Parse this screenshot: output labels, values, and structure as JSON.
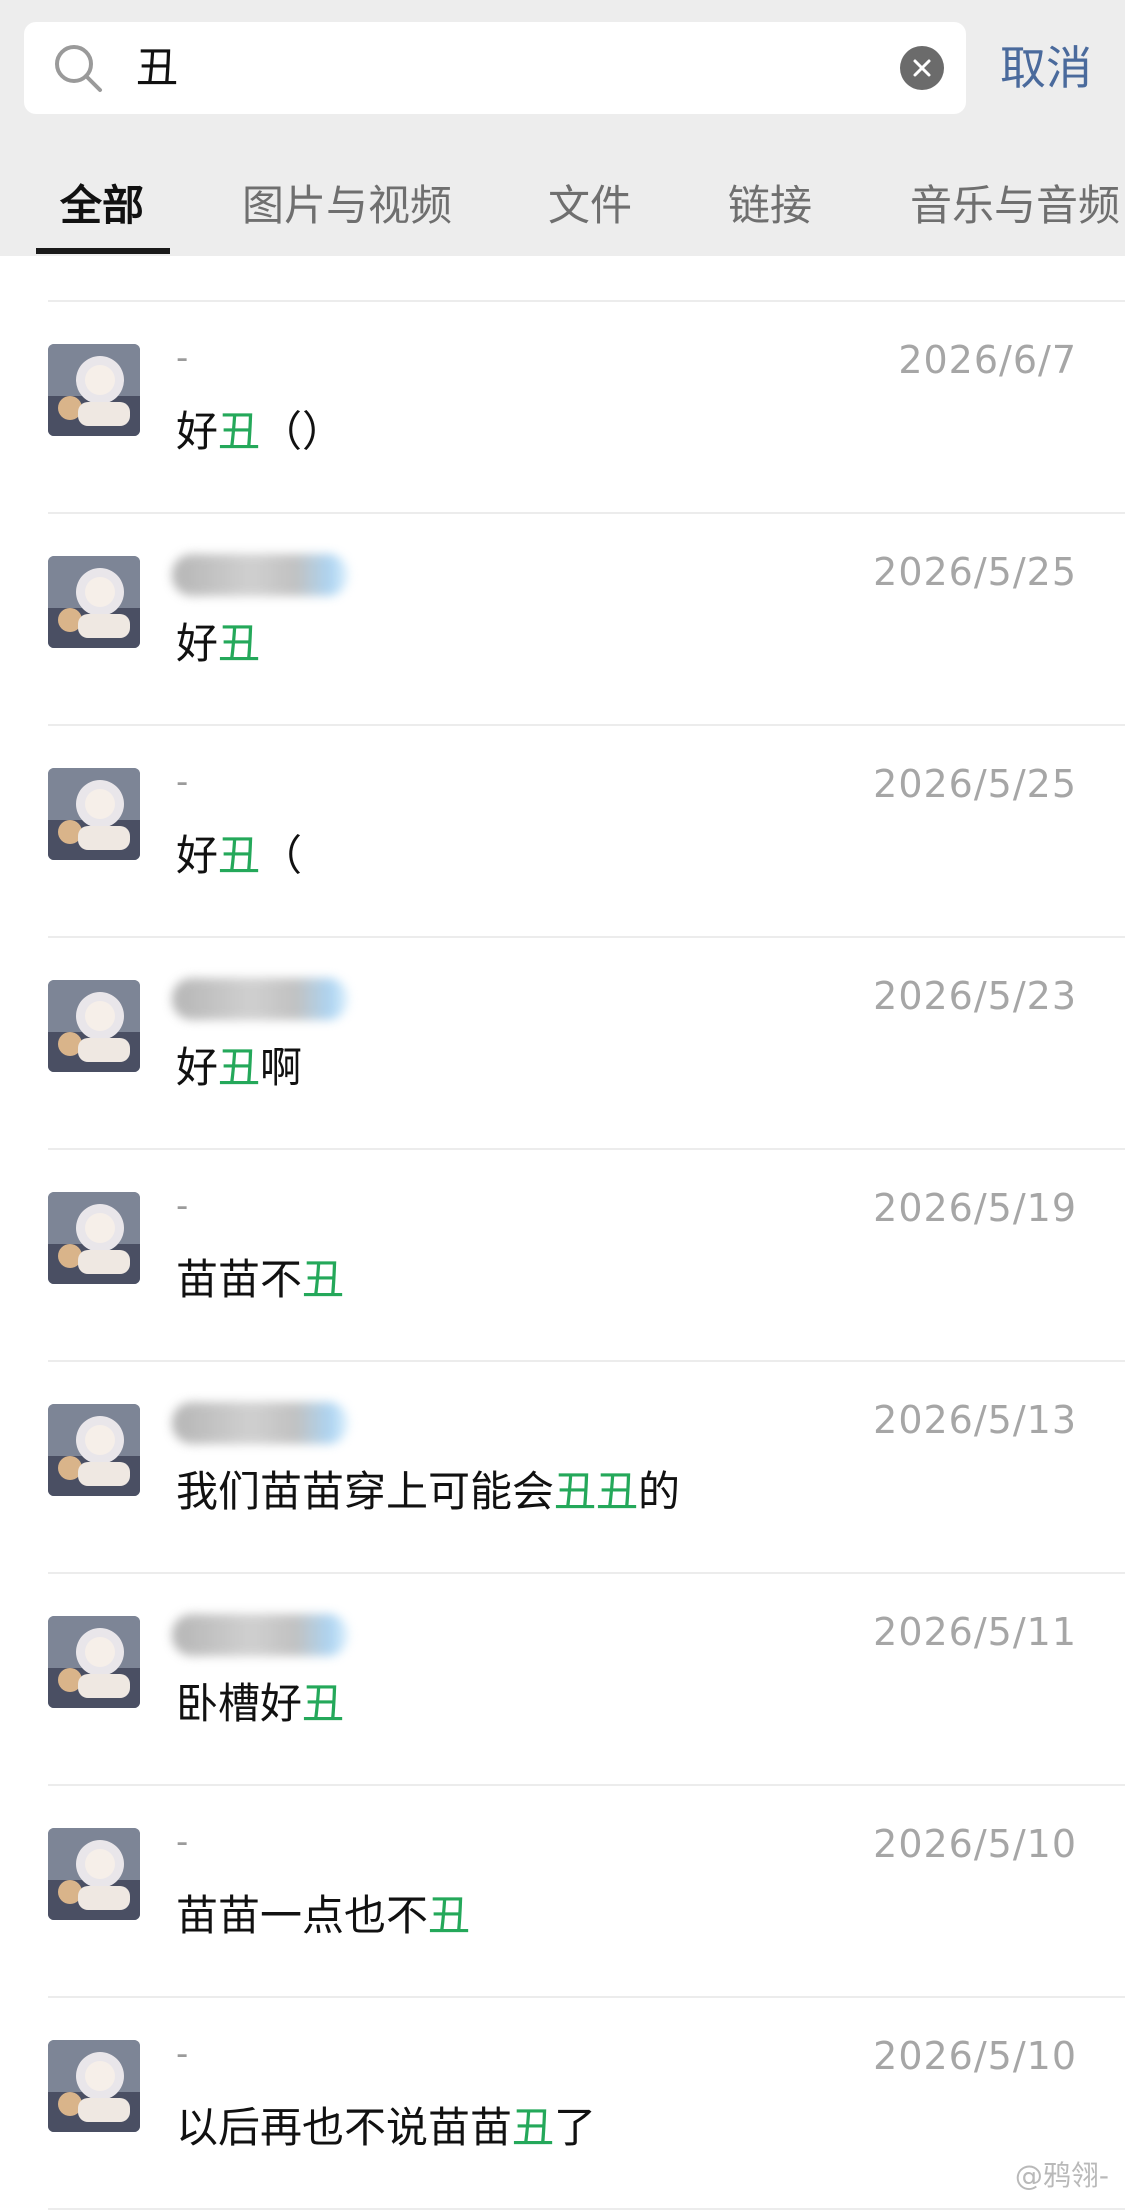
{
  "search": {
    "query": "丑",
    "cancel_label": "取消"
  },
  "tabs": [
    {
      "label": "全部",
      "active": true
    },
    {
      "label": "图片与视频",
      "active": false
    },
    {
      "label": "文件",
      "active": false
    },
    {
      "label": "链接",
      "active": false
    },
    {
      "label": "音乐与音频",
      "active": false
    }
  ],
  "results": [
    {
      "sender": "-",
      "sender_blurred": false,
      "date": "2026/6/7",
      "message": {
        "before": "好",
        "match": "丑",
        "match2": "",
        "after": "（）"
      }
    },
    {
      "sender": "",
      "sender_blurred": true,
      "date": "2026/5/25",
      "message": {
        "before": "好",
        "match": "丑",
        "match2": "",
        "after": ""
      }
    },
    {
      "sender": "-",
      "sender_blurred": false,
      "date": "2026/5/25",
      "message": {
        "before": "好",
        "match": "丑",
        "match2": "",
        "after": "（"
      }
    },
    {
      "sender": "",
      "sender_blurred": true,
      "date": "2026/5/23",
      "message": {
        "before": "好",
        "match": "丑",
        "match2": "",
        "after": "啊"
      }
    },
    {
      "sender": "-",
      "sender_blurred": false,
      "date": "2026/5/19",
      "message": {
        "before": "苗苗不",
        "match": "丑",
        "match2": "",
        "after": ""
      }
    },
    {
      "sender": "",
      "sender_blurred": true,
      "date": "2026/5/13",
      "message": {
        "before": "我们苗苗穿上可能会",
        "match": "丑",
        "match2": "丑",
        "after": "的"
      }
    },
    {
      "sender": "",
      "sender_blurred": true,
      "date": "2026/5/11",
      "message": {
        "before": "卧槽好",
        "match": "丑",
        "match2": "",
        "after": ""
      }
    },
    {
      "sender": "-",
      "sender_blurred": false,
      "date": "2026/5/10",
      "message": {
        "before": "苗苗一点也不",
        "match": "丑",
        "match2": "",
        "after": ""
      }
    },
    {
      "sender": "-",
      "sender_blurred": false,
      "date": "2026/5/10",
      "message": {
        "before": "以后再也不说苗苗",
        "match": "丑",
        "match2": "",
        "after": "了"
      }
    }
  ],
  "watermark": "@鸦翎-",
  "colors": {
    "highlight": "#24a85a",
    "cancel": "#4a6a9c",
    "topbar": "#ededed"
  }
}
